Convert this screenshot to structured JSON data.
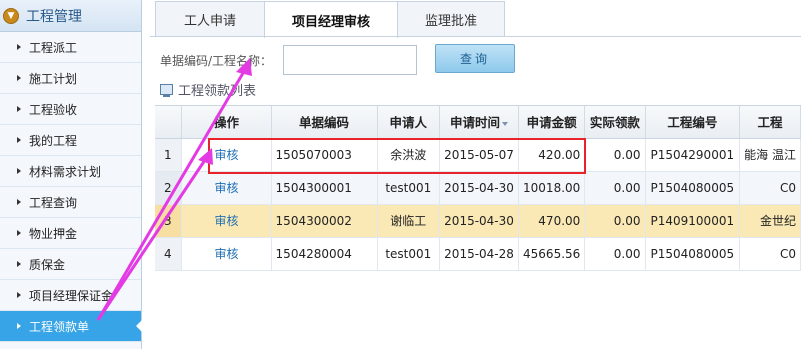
{
  "sidebar": {
    "header": "工程管理",
    "items": [
      {
        "label": "工程派工"
      },
      {
        "label": "施工计划"
      },
      {
        "label": "工程验收"
      },
      {
        "label": "我的工程"
      },
      {
        "label": "材料需求计划"
      },
      {
        "label": "工程查询"
      },
      {
        "label": "物业押金"
      },
      {
        "label": "质保金"
      },
      {
        "label": "项目经理保证金"
      },
      {
        "label": "工程领款单",
        "active": true
      }
    ]
  },
  "tabs": [
    {
      "label": "工人申请"
    },
    {
      "label": "项目经理审核",
      "active": true
    },
    {
      "label": "监理批准"
    }
  ],
  "search": {
    "label": "单据编码/工程名称：",
    "value": "",
    "placeholder": "",
    "button_label": "查询"
  },
  "list": {
    "title": "工程领款列表",
    "columns": [
      "",
      "操作",
      "单据编码",
      "申请人",
      "申请时间",
      "申请金额",
      "实际领款",
      "工程编号",
      "工程"
    ],
    "rows": [
      {
        "num": "1",
        "action": "审核",
        "code": "1505070003",
        "applicant": "余洪波",
        "date": "2015-05-07",
        "amount": "420.00",
        "actual": "0.00",
        "project_no": "P1504290001",
        "project": "能海 温江"
      },
      {
        "num": "2",
        "action": "审核",
        "code": "1504300001",
        "applicant": "test001",
        "date": "2015-04-30",
        "amount": "10018.00",
        "actual": "0.00",
        "project_no": "P1504080005",
        "project": "C0"
      },
      {
        "num": "3",
        "action": "审核",
        "code": "1504300002",
        "applicant": "谢临工",
        "date": "2015-04-30",
        "amount": "470.00",
        "actual": "0.00",
        "project_no": "P1409100001",
        "project": "金世纪"
      },
      {
        "num": "4",
        "action": "审核",
        "code": "1504280004",
        "applicant": "test001",
        "date": "2015-04-28",
        "amount": "45665.56",
        "actual": "0.00",
        "project_no": "P1504080005",
        "project": "C0"
      }
    ]
  },
  "colors": {
    "active_sidebar": "#36a4e6",
    "highlight_row": "#fbe9b5",
    "annotation_red": "#e8242a",
    "annotation_magenta": "#e43ae4",
    "link": "#1f6fb5"
  }
}
